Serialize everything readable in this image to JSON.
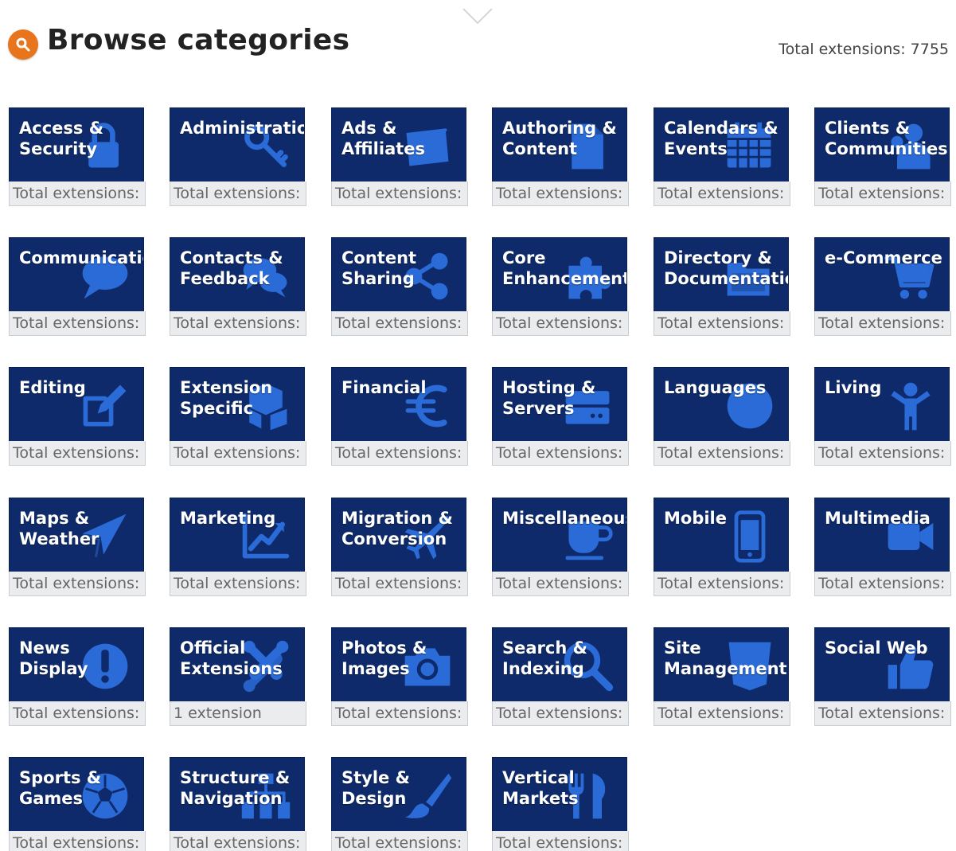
{
  "header": {
    "title": "Browse categories",
    "total_label": "Total extensions: 7755",
    "search_icon": "search-icon"
  },
  "colors": {
    "tile_bg": "#0e2a6a",
    "icon": "#2a6bd8",
    "accent": "#e8741c",
    "footer_bg": "#eaecee"
  },
  "categories": [
    {
      "label": "Access &\nSecurity",
      "count": "Total extensions:",
      "icon": "lock-icon"
    },
    {
      "label": "Administration",
      "count": "Total extensions:",
      "icon": "key-icon"
    },
    {
      "label": "Ads &\nAffiliates",
      "count": "Total extensions:",
      "icon": "envelope-icon"
    },
    {
      "label": "Authoring &\nContent",
      "count": "Total extensions:",
      "icon": "document-icon"
    },
    {
      "label": "Calendars &\nEvents",
      "count": "Total extensions:",
      "icon": "calendar-icon"
    },
    {
      "label": "Clients &\nCommunities",
      "count": "Total extensions:",
      "icon": "users-icon"
    },
    {
      "label": "Communication",
      "count": "Total extensions:",
      "icon": "speech-bubble-icon"
    },
    {
      "label": "Contacts &\nFeedback",
      "count": "Total extensions:",
      "icon": "chat-bubbles-icon"
    },
    {
      "label": "Content\nSharing",
      "count": "Total extensions:",
      "icon": "share-icon"
    },
    {
      "label": "Core\nEnhancements",
      "count": "Total extensions:",
      "icon": "puzzle-icon"
    },
    {
      "label": "Directory &\nDocumentation",
      "count": "Total extensions:",
      "icon": "folder-icon"
    },
    {
      "label": "e-Commerce",
      "count": "Total extensions:",
      "icon": "cart-icon"
    },
    {
      "label": "Editing",
      "count": "Total extensions:",
      "icon": "edit-icon"
    },
    {
      "label": "Extension\nSpecific",
      "count": "Total extensions:",
      "icon": "cubes-icon"
    },
    {
      "label": "Financial",
      "count": "Total extensions:",
      "icon": "euro-icon"
    },
    {
      "label": "Hosting &\nServers",
      "count": "Total extensions:",
      "icon": "server-icon"
    },
    {
      "label": "Languages",
      "count": "Total extensions:",
      "icon": "globe-icon"
    },
    {
      "label": "Living",
      "count": "Total extensions:",
      "icon": "child-icon"
    },
    {
      "label": "Maps &\nWeather",
      "count": "Total extensions:",
      "icon": "location-arrow-icon"
    },
    {
      "label": "Marketing",
      "count": "Total extensions:",
      "icon": "line-chart-icon"
    },
    {
      "label": "Migration &\nConversion",
      "count": "Total extensions:",
      "icon": "plane-icon"
    },
    {
      "label": "Miscellaneous",
      "count": "Total extensions:",
      "icon": "coffee-cup-icon"
    },
    {
      "label": "Mobile",
      "count": "Total extensions:",
      "icon": "smartphone-icon"
    },
    {
      "label": "Multimedia",
      "count": "Total extensions:",
      "icon": "video-camera-icon"
    },
    {
      "label": "News\nDisplay",
      "count": "Total extensions:",
      "icon": "exclamation-icon"
    },
    {
      "label": "Official\nExtensions",
      "count": "1 extension",
      "icon": "joomla-logo-icon"
    },
    {
      "label": "Photos &\nImages",
      "count": "Total extensions:",
      "icon": "camera-icon"
    },
    {
      "label": "Search &\nIndexing",
      "count": "Total extensions:",
      "icon": "magnifier-icon"
    },
    {
      "label": "Site\nManagement",
      "count": "Total extensions:",
      "icon": "html5-icon"
    },
    {
      "label": "Social Web",
      "count": "Total extensions:",
      "icon": "thumbs-up-icon"
    },
    {
      "label": "Sports &\nGames",
      "count": "Total extensions:",
      "icon": "soccer-ball-icon"
    },
    {
      "label": "Structure &\nNavigation",
      "count": "Total extensions:",
      "icon": "sitemap-icon"
    },
    {
      "label": "Style &\nDesign",
      "count": "Total extensions:",
      "icon": "paintbrush-icon"
    },
    {
      "label": "Vertical\nMarkets",
      "count": "Total extensions:",
      "icon": "cutlery-icon"
    }
  ]
}
